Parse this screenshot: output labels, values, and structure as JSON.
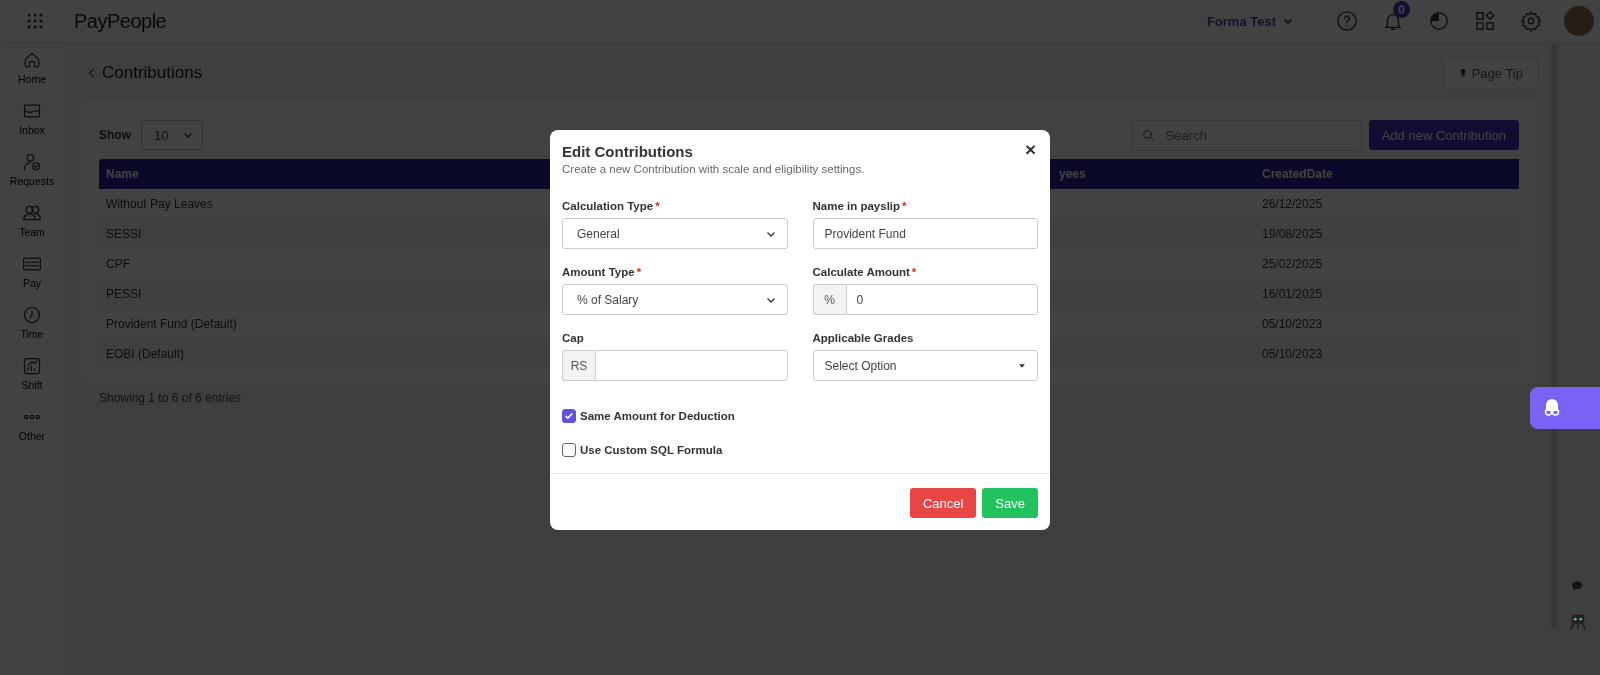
{
  "top_bar": {
    "logo": "PayPeople",
    "company": "Forma Test",
    "notification_count": "0"
  },
  "sidebar": {
    "items": [
      {
        "label": "Home",
        "kind": "home"
      },
      {
        "label": "Inbox",
        "kind": "inbox"
      },
      {
        "label": "Requests",
        "kind": "requests"
      },
      {
        "label": "Team",
        "kind": "team"
      },
      {
        "label": "Pay",
        "kind": "pay"
      },
      {
        "label": "Time",
        "kind": "time"
      },
      {
        "label": "Shift",
        "kind": "shift"
      },
      {
        "label": "Other",
        "kind": "other"
      }
    ]
  },
  "page": {
    "title": "Contributions",
    "page_tip": "Page Tip",
    "show_label": "Show",
    "page_size": "10",
    "search": {
      "placeholder": "Search"
    },
    "add_button": "Add new Contribution",
    "table": {
      "columns": [
        "Name",
        "yees",
        "CreatedDate"
      ],
      "rows": [
        {
          "name": "Without Pay Leaves",
          "created": "26/12/2025"
        },
        {
          "name": "SESSI",
          "created": "19/08/2025"
        },
        {
          "name": "CPF",
          "created": "25/02/2025"
        },
        {
          "name": "PESSI",
          "created": "16/01/2025"
        },
        {
          "name": "Provident Fund (Default)",
          "created": "05/10/2023"
        },
        {
          "name": "EOBI (Default)",
          "created": "05/10/2023"
        }
      ]
    },
    "footer": "Showing 1 to 6 of 6 entries"
  },
  "modal": {
    "title": "Edit Contributions",
    "subtitle": "Create a new Contribution with scale and eligibility settings.",
    "close": "×",
    "fields": [
      {
        "label": "Calculation Type",
        "required": true,
        "kind": "select",
        "value": "General"
      },
      {
        "label": "Name in payslip",
        "required": true,
        "kind": "text",
        "value": "Provident Fund"
      },
      {
        "label": "Amount Type",
        "required": true,
        "kind": "select",
        "value": "% of Salary"
      },
      {
        "label": "Calculate Amount",
        "required": true,
        "kind": "addon",
        "addon": "%",
        "value": "0"
      },
      {
        "label": "Cap",
        "required": false,
        "kind": "addon",
        "addon": "RS"
      },
      {
        "label": "Applicable Grades",
        "required": false,
        "kind": "dropdown",
        "placeholder": "Select Option"
      }
    ],
    "required_mark": "*",
    "checkboxes": [
      {
        "label": "Same Amount for Deduction",
        "checked": true
      },
      {
        "label": "Use Custom SQL Formula",
        "checked": false
      }
    ],
    "buttons": [
      {
        "label": "Cancel",
        "kind": "danger"
      },
      {
        "label": "Save",
        "kind": "primary"
      }
    ]
  }
}
